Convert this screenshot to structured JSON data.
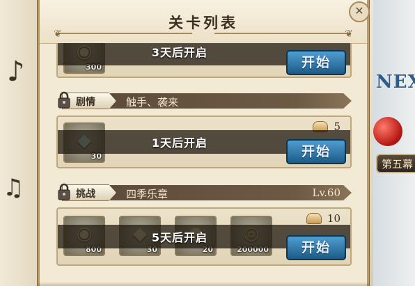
{
  "dialog": {
    "title": "关卡列表",
    "close_glyph": "✕"
  },
  "background": {
    "next_art_text": "NEX",
    "stage_badge_text": "第五幕"
  },
  "stages": [
    {
      "locked_text": "3天后开启",
      "items": [
        {
          "icon": "pouch-icon",
          "glyph": "◉",
          "qty": "300"
        }
      ],
      "start_label": "开始"
    },
    {
      "tag": "剧情",
      "name": "触手、袭来",
      "level": "",
      "stamina": "5",
      "locked_text": "1天后开启",
      "items": [
        {
          "icon": "rainbow-gem-icon",
          "glyph": "◆",
          "qty": "30"
        }
      ],
      "start_label": "开始"
    },
    {
      "tag": "挑战",
      "name": "四季乐章",
      "level": "Lv.60",
      "stamina": "10",
      "locked_text": "5天后开启",
      "items": [
        {
          "icon": "pouch-icon",
          "glyph": "◉",
          "qty": "800"
        },
        {
          "icon": "crystal-icon",
          "glyph": "◆",
          "qty": "30"
        },
        {
          "icon": "bag-icon",
          "glyph": "●",
          "qty": "20"
        },
        {
          "icon": "gold-coin-icon",
          "glyph": "◎",
          "qty": "200000"
        }
      ],
      "start_label": "开始"
    }
  ]
}
